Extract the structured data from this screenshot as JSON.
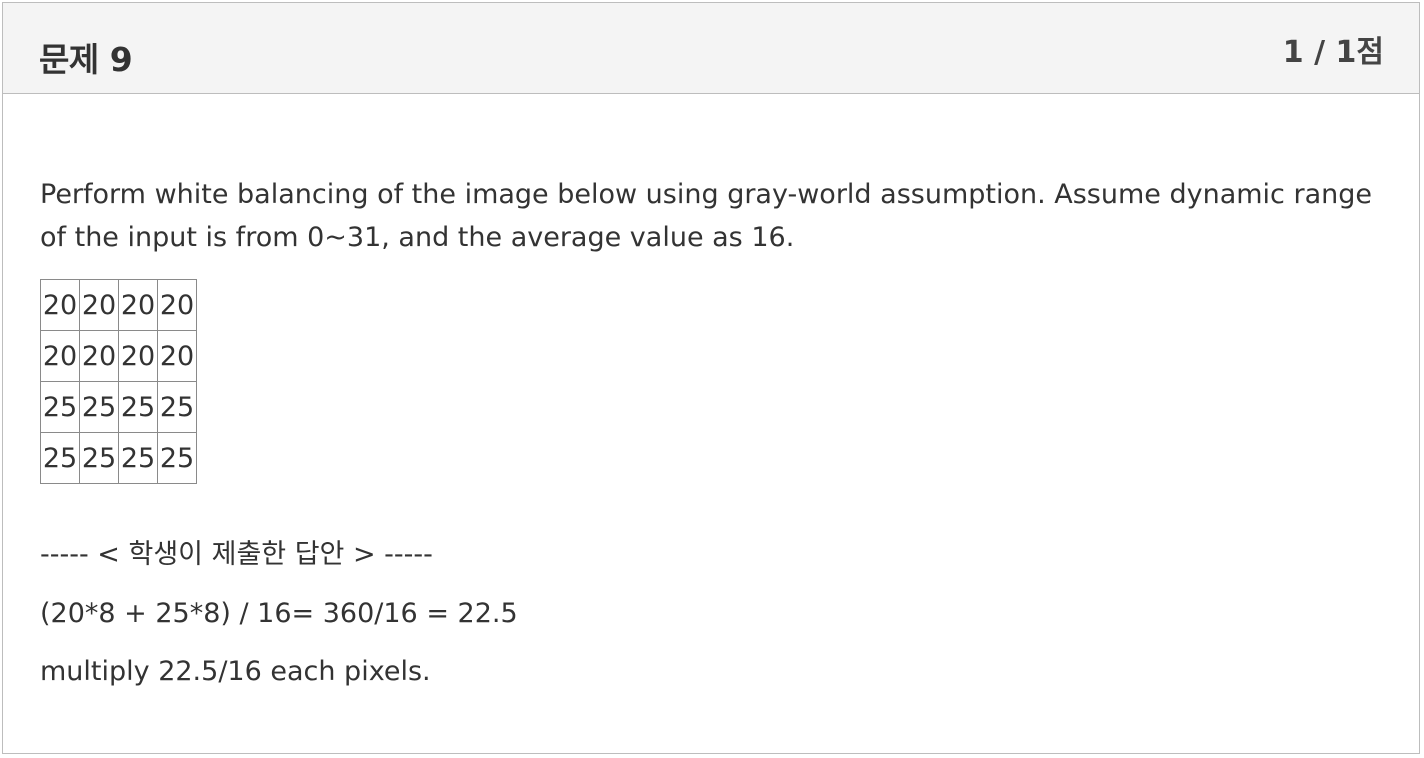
{
  "question": {
    "title": "문제 9",
    "score": "1 / 1점",
    "prompt": "Perform white balancing of the image below using gray-world assumption. Assume dynamic range of the input is from 0~31, and the average value as 16.",
    "pixel_table": [
      [
        "20",
        "20",
        "20",
        "20"
      ],
      [
        "20",
        "20",
        "20",
        "20"
      ],
      [
        "25",
        "25",
        "25",
        "25"
      ],
      [
        "25",
        "25",
        "25",
        "25"
      ]
    ]
  },
  "answer": {
    "header": "----- < 학생이 제출한 답안 > -----",
    "lines": [
      "(20*8 + 25*8) / 16= 360/16 = 22.5",
      "multiply 22.5/16 each pixels."
    ]
  }
}
